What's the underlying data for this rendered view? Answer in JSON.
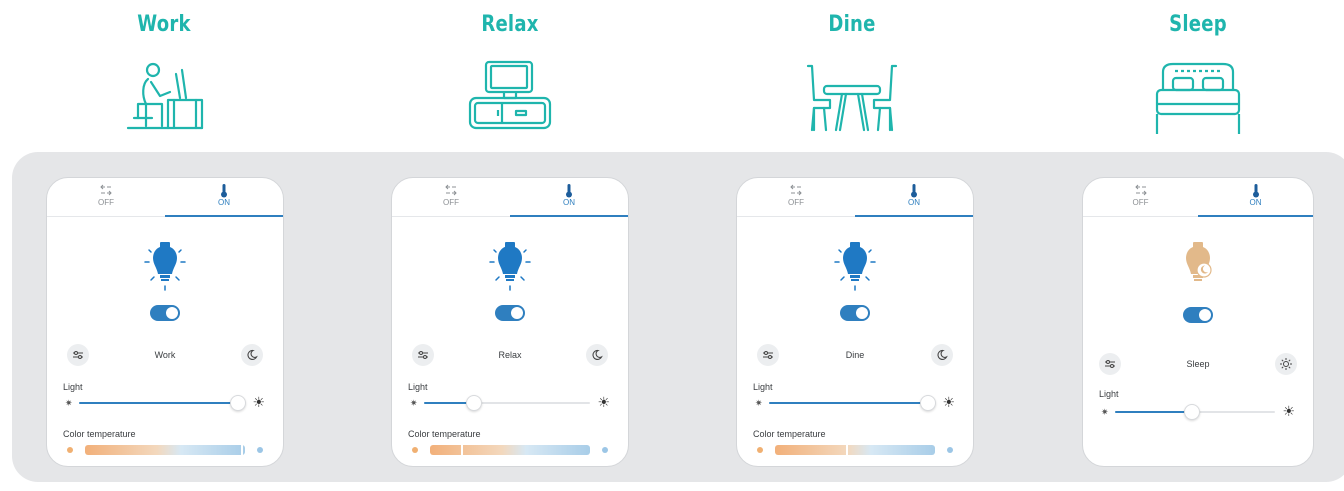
{
  "scenes": [
    {
      "title": "Work",
      "icon": "desk-work-icon"
    },
    {
      "title": "Relax",
      "icon": "tv-relax-icon"
    },
    {
      "title": "Dine",
      "icon": "dining-table-icon"
    },
    {
      "title": "Sleep",
      "icon": "bed-sleep-icon"
    }
  ],
  "colors": {
    "accent_teal": "#1fb5ad",
    "accent_blue": "#2f7fbf",
    "panel_bg": "#e5e6e8",
    "sleep_bulb": "#e2b98a"
  },
  "cards": [
    {
      "tabs": {
        "off": "OFF",
        "on": "ON",
        "active": "ON"
      },
      "bulb": "blue-bulb-icon",
      "toggle_on": true,
      "mode_label": "Work",
      "left_button_icon": "sliders-icon",
      "right_button_icon": "moon-icon",
      "light_label": "Light",
      "light_value": 0.96,
      "color_temp_label": "Color temperature",
      "color_temp_value": 0.98
    },
    {
      "tabs": {
        "off": "OFF",
        "on": "ON",
        "active": "ON"
      },
      "bulb": "blue-bulb-icon",
      "toggle_on": true,
      "mode_label": "Relax",
      "left_button_icon": "sliders-icon",
      "right_button_icon": "moon-icon",
      "light_label": "Light",
      "light_value": 0.3,
      "color_temp_label": "Color temperature",
      "color_temp_value": 0.2
    },
    {
      "tabs": {
        "off": "OFF",
        "on": "ON",
        "active": "ON"
      },
      "bulb": "blue-bulb-icon",
      "toggle_on": true,
      "mode_label": "Dine",
      "left_button_icon": "sliders-icon",
      "right_button_icon": "moon-icon",
      "light_label": "Light",
      "light_value": 0.96,
      "color_temp_label": "Color temperature",
      "color_temp_value": 0.45
    },
    {
      "tabs": {
        "off": "OFF",
        "on": "ON",
        "active": "ON"
      },
      "bulb": "sleep-bulb-icon",
      "toggle_on": true,
      "mode_label": "Sleep",
      "left_button_icon": "sliders-icon",
      "right_button_icon": "sun-icon",
      "light_label": "Light",
      "light_value": 0.48
    }
  ]
}
